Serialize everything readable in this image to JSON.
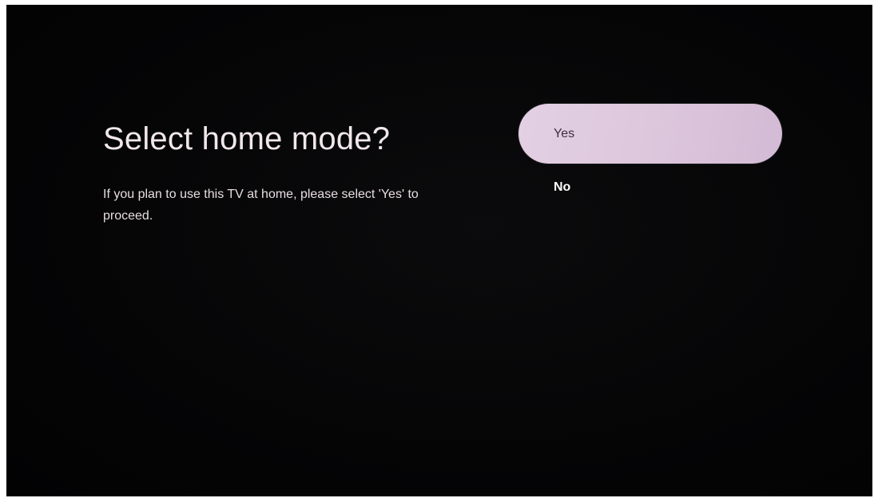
{
  "dialog": {
    "title": "Select home mode?",
    "description": "If you plan to use this TV at home, please select 'Yes' to proceed."
  },
  "options": [
    {
      "label": "Yes",
      "selected": true
    },
    {
      "label": "No",
      "selected": false
    }
  ],
  "colors": {
    "background": "#050506",
    "focused_option": "#dcc6dc",
    "text": "#f1e7ea"
  }
}
